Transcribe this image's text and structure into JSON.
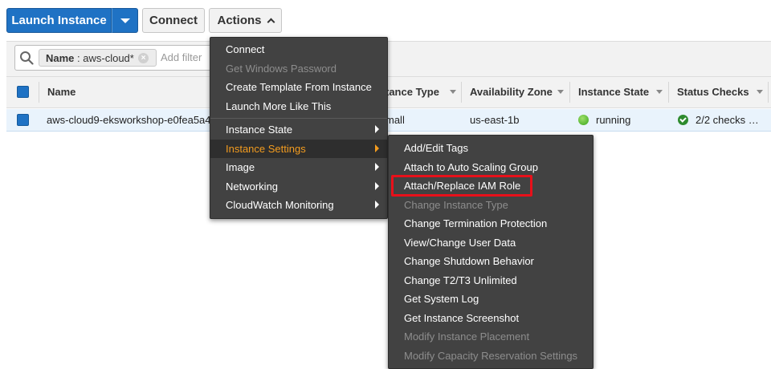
{
  "toolbar": {
    "launch_label": "Launch Instance",
    "connect_label": "Connect",
    "actions_label": "Actions"
  },
  "filter": {
    "token_key": "Name",
    "token_sep": " : ",
    "token_value": "aws-cloud*",
    "add_filter_label": "Add filter"
  },
  "table": {
    "headers": {
      "name": "Name",
      "instance_type": "tance Type",
      "availability_zone": "Availability Zone",
      "instance_state": "Instance State",
      "status_checks": "Status Checks"
    },
    "row": {
      "name": "aws-cloud9-eksworkshop-e0fea5a4",
      "instance_type": "mall",
      "availability_zone": "us-east-1b",
      "instance_state": "running",
      "status_checks": "2/2 checks …"
    }
  },
  "actions_menu": {
    "items": [
      {
        "label": "Connect",
        "disabled": false
      },
      {
        "label": "Get Windows Password",
        "disabled": true
      },
      {
        "label": "Create Template From Instance",
        "disabled": false
      },
      {
        "label": "Launch More Like This",
        "disabled": false
      },
      {
        "label": "Instance State",
        "disabled": false,
        "submenu": true
      },
      {
        "label": "Instance Settings",
        "disabled": false,
        "submenu": true,
        "active": true
      },
      {
        "label": "Image",
        "disabled": false,
        "submenu": true
      },
      {
        "label": "Networking",
        "disabled": false,
        "submenu": true
      },
      {
        "label": "CloudWatch Monitoring",
        "disabled": false,
        "submenu": true
      }
    ]
  },
  "instance_settings_menu": {
    "items": [
      {
        "label": "Add/Edit Tags",
        "disabled": false
      },
      {
        "label": "Attach to Auto Scaling Group",
        "disabled": false
      },
      {
        "label": "Attach/Replace IAM Role",
        "disabled": false,
        "highlighted": true
      },
      {
        "label": "Change Instance Type",
        "disabled": true
      },
      {
        "label": "Change Termination Protection",
        "disabled": false
      },
      {
        "label": "View/Change User Data",
        "disabled": false
      },
      {
        "label": "Change Shutdown Behavior",
        "disabled": false
      },
      {
        "label": "Change T2/T3 Unlimited",
        "disabled": false
      },
      {
        "label": "Get System Log",
        "disabled": false
      },
      {
        "label": "Get Instance Screenshot",
        "disabled": false
      },
      {
        "label": "Modify Instance Placement",
        "disabled": true
      },
      {
        "label": "Modify Capacity Reservation Settings",
        "disabled": true
      }
    ]
  },
  "colors": {
    "primary": "#1f72c4",
    "menu_bg": "#424242",
    "menu_active": "#f39c1f",
    "highlight_border": "#e8101a",
    "running": "#3aa51c"
  }
}
